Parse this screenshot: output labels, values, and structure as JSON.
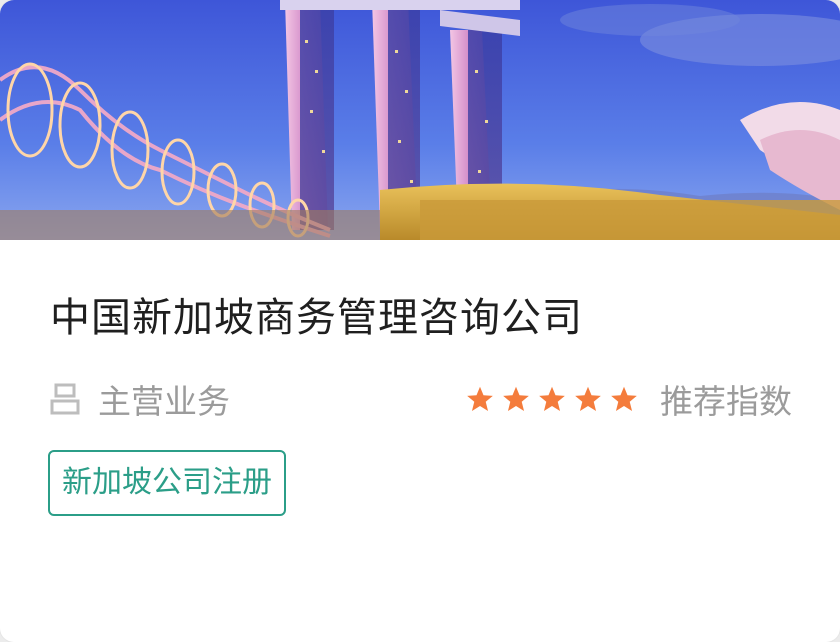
{
  "company": {
    "name": "中国新加坡商务管理咨询公司"
  },
  "business": {
    "icon": "business-icon",
    "label": "主营业务"
  },
  "rating": {
    "stars": 5,
    "max_stars": 5,
    "star_color": "#f47c3c",
    "label": "推荐指数"
  },
  "tags": [
    {
      "label": "新加坡公司注册"
    }
  ],
  "colors": {
    "tag_accent": "#2b9e88",
    "muted_text": "#9b9b9b",
    "title_text": "#1f1f1f"
  }
}
